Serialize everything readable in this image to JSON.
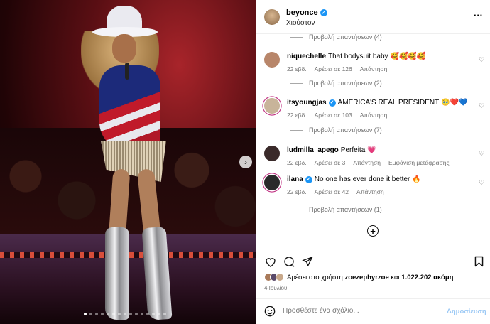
{
  "post": {
    "username": "beyonce",
    "location": "Χιούστον",
    "carousel": {
      "slide_count": 15,
      "active_index": 0
    }
  },
  "comments": [
    {
      "type": "replies",
      "label": "Προβολή απαντήσεων (4)"
    },
    {
      "type": "comment",
      "username": "niquechelle",
      "verified": false,
      "text": "That bodysuit baby",
      "emoji": "🥰🥰🥰🥰",
      "emoji_class": "emoji-red",
      "time": "22 εβδ.",
      "likes": "Αρέσει σε 126",
      "reply": "Απάντηση",
      "extra": ""
    },
    {
      "type": "replies",
      "label": "Προβολή απαντήσεων (2)"
    },
    {
      "type": "comment",
      "username": "itsyoungjas",
      "verified": true,
      "text": "AMERICA'S REAL PRESIDENT",
      "emoji": "🥹❤️💙",
      "emoji_class": "emoji-red",
      "time": "22 εβδ.",
      "likes": "Αρέσει σε 103",
      "reply": "Απάντηση",
      "extra": ""
    },
    {
      "type": "replies",
      "label": "Προβολή απαντήσεων (7)"
    },
    {
      "type": "comment",
      "username": "ludmilla_apego",
      "verified": false,
      "text": "Perfeita",
      "emoji": "💗",
      "emoji_class": "emoji-red",
      "time": "22 εβδ.",
      "likes": "Αρέσει σε 3",
      "reply": "Απάντηση",
      "extra": "Εμφάνιση μετάφρασης"
    },
    {
      "type": "comment",
      "username": "ilana",
      "verified": true,
      "text": "No one has ever done it better",
      "emoji": "🔥",
      "emoji_class": "emoji-fire",
      "time": "22 εβδ.",
      "likes": "Αρέσει σε 42",
      "reply": "Απάντηση",
      "extra": ""
    },
    {
      "type": "replies",
      "label": "Προβολή απαντήσεων (1)"
    }
  ],
  "likes_summary": {
    "prefix": "Αρέσει στο χρήστη",
    "user": "zoezephyrzoe",
    "conj": "και",
    "count": "1.022.202",
    "suffix": "ακόμη"
  },
  "post_date": "4 Ιουλίου",
  "composer": {
    "placeholder": "Προσθέστε ένα σχόλιο...",
    "post_label": "Δημοσίευση"
  },
  "icons": {
    "more": "more-options-icon",
    "next": "chevron-right-icon",
    "like": "heart-icon",
    "comment": "comment-icon",
    "share": "send-icon",
    "save": "bookmark-icon",
    "emoji": "smile-icon",
    "load_more": "plus-circle-icon"
  },
  "colors": {
    "verified": "#1b95f5",
    "muted": "#737373",
    "post_disabled": "#9cc9f5"
  }
}
